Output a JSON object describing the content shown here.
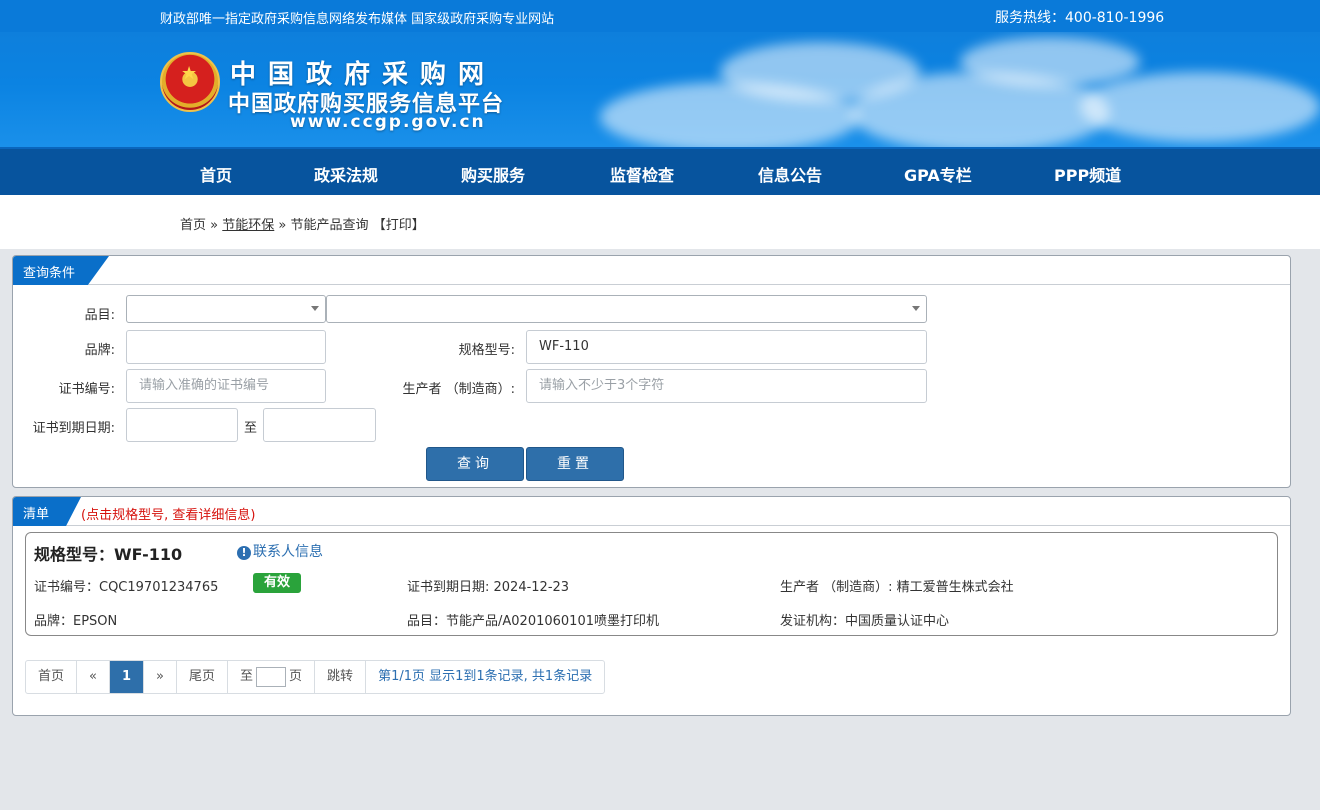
{
  "top": {
    "slogan": "财政部唯一指定政府采购信息网络发布媒体 国家级政府采购专业网站",
    "hotline": "服务热线：400-810-1996"
  },
  "logo": {
    "title": "中国政府采购网",
    "subtitle": "中国政府购买服务信息平台",
    "url": "www.ccgp.gov.cn"
  },
  "nav": [
    "首页",
    "政采法规",
    "购买服务",
    "监督检查",
    "信息公告",
    "GPA专栏",
    "PPP频道"
  ],
  "breadcrumb": {
    "home": "首页",
    "sep1": "»",
    "section": "节能环保",
    "sep2": "»",
    "current": "节能产品查询",
    "print": "【打印】"
  },
  "query": {
    "tab": "查询条件",
    "category_label": "品目:",
    "category_value1": "",
    "category_value2": "",
    "brand_label": "品牌:",
    "brand_value": "",
    "model_label": "规格型号:",
    "model_value": "WF-110",
    "cert_label": "证书编号:",
    "cert_placeholder": "请输入准确的证书编号",
    "maker_label": "生产者 （制造商）:",
    "maker_placeholder": "请输入不少于3个字符",
    "expiry_label": "证书到期日期:",
    "expiry_from": "",
    "to_label": "至",
    "expiry_to": "",
    "search_button": "查询",
    "reset_button": "重置"
  },
  "list": {
    "tab": "清单",
    "hint": "(点击规格型号, 查看详细信息)",
    "items": [
      {
        "model": "规格型号：WF-110",
        "contact": "联系人信息",
        "cert_no": "证书编号：CQC19701234765",
        "status": "有效",
        "expiry": "证书到期日期: 2024-12-23",
        "maker": "生产者 （制造商）: 精工爱普生株式会社",
        "brand": "品牌：EPSON",
        "category": "品目：节能产品/A0201060101喷墨打印机",
        "issuer": "发证机构：中国质量认证中心"
      }
    ]
  },
  "pagination": {
    "first": "首页",
    "prev": "«",
    "current": "1",
    "next": "»",
    "last": "尾页",
    "to": "至",
    "page_unit": "页",
    "jump": "跳转",
    "summary": "第1/1页  显示1到1条记录, 共1条记录"
  },
  "colors": {
    "topbar": "#0a7ad9",
    "nav": "#07549e",
    "tab": "#0a6fc9",
    "button": "#2e6faa",
    "badge": "#2aa33b",
    "hint": "#d6120d"
  }
}
